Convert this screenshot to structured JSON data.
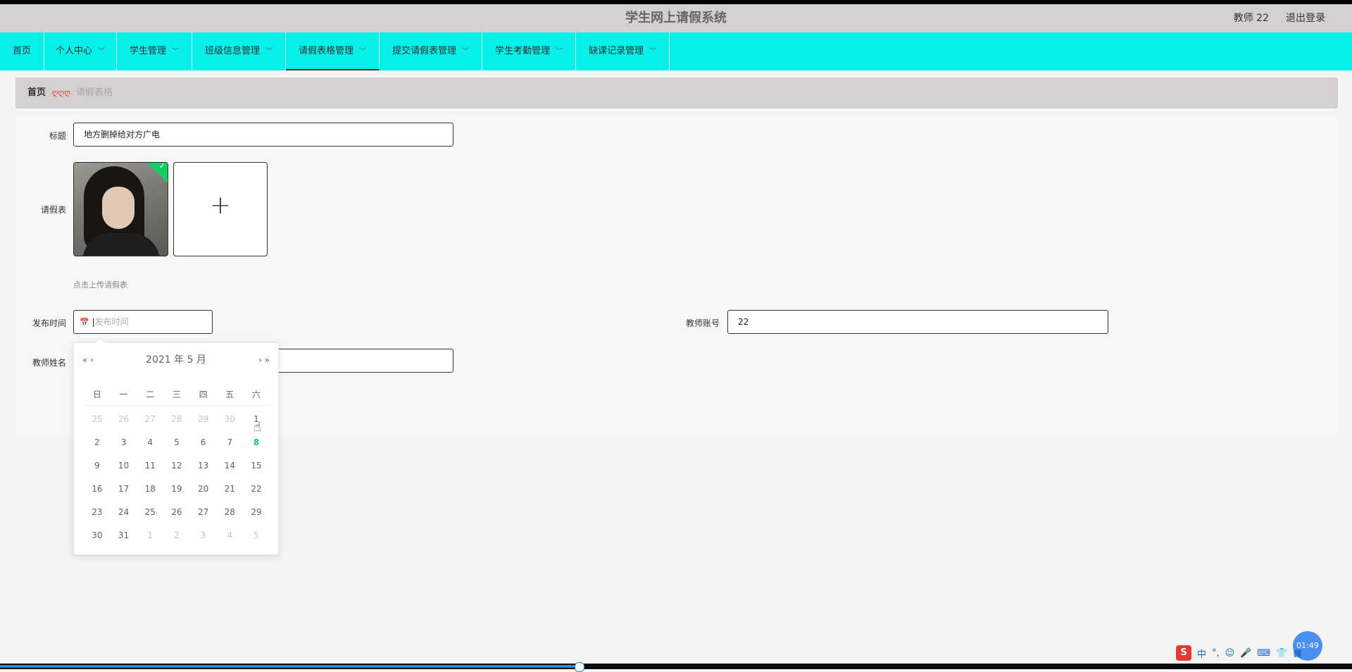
{
  "header": {
    "title": "学生网上请假系统",
    "user": "教师 22",
    "logout": "退出登录"
  },
  "nav": {
    "items": [
      {
        "label": "首页",
        "caret": ""
      },
      {
        "label": "个人中心",
        "caret": "﹀"
      },
      {
        "label": "学生管理",
        "caret": "﹀"
      },
      {
        "label": "班级信息管理",
        "caret": "﹀"
      },
      {
        "label": "请假表格管理",
        "caret": "﹀"
      },
      {
        "label": "提交请假表管理",
        "caret": "﹀"
      },
      {
        "label": "学生考勤管理",
        "caret": "﹀"
      },
      {
        "label": "缺课记录管理",
        "caret": "﹀"
      }
    ]
  },
  "breadcrumb": {
    "home": "首页",
    "separator": "ღღღ",
    "current": "请假表格"
  },
  "form": {
    "title_label": "标题",
    "title_value": "地方删掉给对方广电",
    "sheet_label": "请假表",
    "upload_plus": "+",
    "upload_hint": "点击上传请假表",
    "publish_label": "发布时间",
    "publish_placeholder": "发布时间",
    "calendar_icon": "📅",
    "teacher_account_label": "教师账号",
    "teacher_account_value": "22",
    "teacher_name_label": "教师姓名",
    "teacher_name_value": ""
  },
  "calendar": {
    "heading": "2021 年  5 月",
    "prev": "« ‹",
    "next": "› »",
    "weekdays": [
      "日",
      "一",
      "二",
      "三",
      "四",
      "五",
      "六"
    ],
    "weeks": [
      [
        "25",
        "26",
        "27",
        "28",
        "29",
        "30",
        "1"
      ],
      [
        "2",
        "3",
        "4",
        "5",
        "6",
        "7",
        "8"
      ],
      [
        "9",
        "10",
        "11",
        "12",
        "13",
        "14",
        "15"
      ],
      [
        "16",
        "17",
        "18",
        "19",
        "20",
        "21",
        "22"
      ],
      [
        "23",
        "24",
        "25",
        "26",
        "27",
        "28",
        "29"
      ],
      [
        "30",
        "31",
        "1",
        "2",
        "3",
        "4",
        "5"
      ]
    ]
  },
  "system": {
    "ime_logo": "S",
    "ime_mode": "中",
    "ime_punct": "°,",
    "clock": "01:49"
  },
  "colors": {
    "nav_bg": "#05f0ea",
    "header_bg": "#d6cfcf",
    "today": "#13ce66"
  }
}
